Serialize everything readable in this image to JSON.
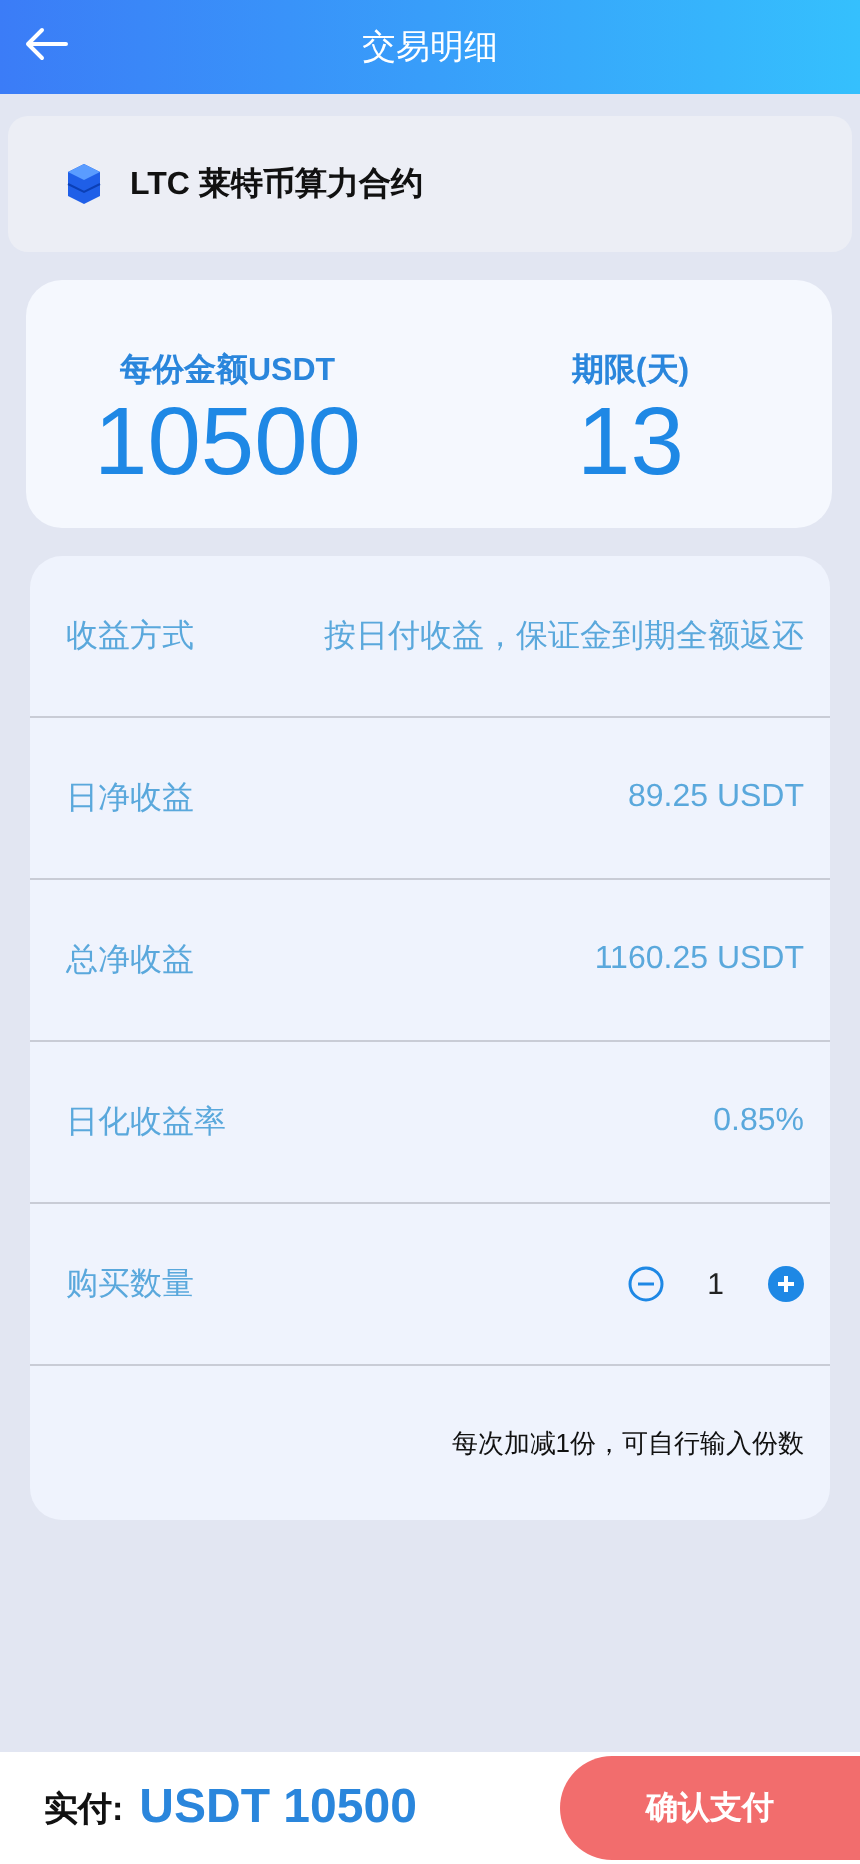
{
  "header": {
    "title": "交易明细"
  },
  "product": {
    "name": "LTC 莱特币算力合约"
  },
  "stats": [
    {
      "label": "每份金额USDT",
      "value": "10500"
    },
    {
      "label": "期限(天)",
      "value": "13"
    }
  ],
  "rows": [
    {
      "label": "收益方式",
      "value": "按日付收益，保证金到期全额返还"
    },
    {
      "label": "日净收益",
      "value": "89.25 USDT"
    },
    {
      "label": "总净收益",
      "value": "1160.25 USDT"
    },
    {
      "label": "日化收益率",
      "value": "0.85%"
    }
  ],
  "quantity": {
    "label": "购买数量",
    "value": "1",
    "note": "每次加减1份，可自行输入份数"
  },
  "footer": {
    "label": "实付:",
    "amount": "USDT 10500",
    "button": "确认支付"
  }
}
